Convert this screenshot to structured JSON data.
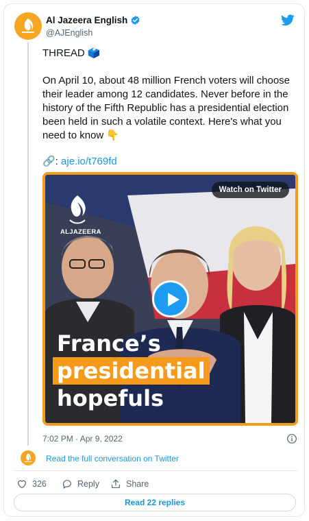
{
  "author": {
    "name": "Al Jazeera English",
    "handle": "@AJEnglish",
    "verified": true,
    "brand_color": "#f5a623"
  },
  "tweet": {
    "line1": "THREAD 🗳️",
    "body": "On April 10, about 48 million French voters will choose their leader among 12 candidates. Never before in the history of the Fifth Republic has a presidential election been held in such a volatile context. Here's what you need to know 👇",
    "link_prefix": "🔗: ",
    "link_text": "aje.io/t769fd"
  },
  "media": {
    "watch_label": "Watch on Twitter",
    "brand_text": "ALJAZEERA",
    "headline_line1": "France’s",
    "headline_line2": "presidential",
    "headline_line3": "hopefuls",
    "accent_color": "#f59a1b",
    "play_color": "#1d9bf0"
  },
  "meta": {
    "timestamp": "7:02 PM · Apr 9, 2022",
    "read_conversation": "Read the full conversation on Twitter"
  },
  "actions": {
    "like_count": "326",
    "reply_label": "Reply",
    "share_label": "Share",
    "read_replies": "Read 22 replies"
  },
  "icons": [
    "verified-icon",
    "twitter-bird-icon",
    "info-icon",
    "heart-icon",
    "reply-icon",
    "share-icon",
    "play-icon",
    "aljazeera-logo-icon"
  ]
}
